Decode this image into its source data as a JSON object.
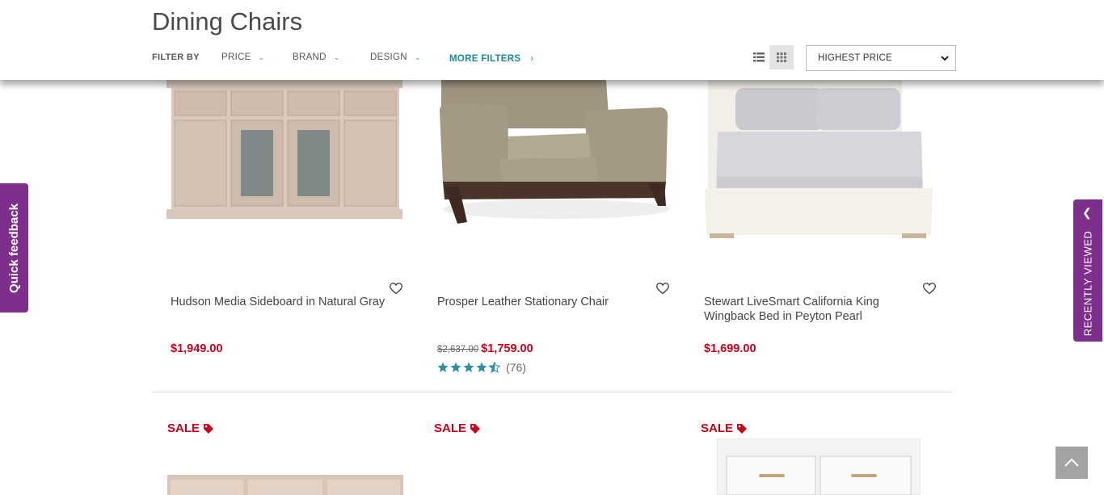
{
  "header": {
    "title": "Dining Chairs",
    "filter_by": "FILTER BY",
    "filters": [
      "PRICE",
      "BRAND",
      "DESIGN"
    ],
    "more_filters": "MORE FILTERS",
    "sort_value": "HIGHEST PRICE"
  },
  "products": [
    {
      "name": "Hudson Media Sideboard in Natural Gray",
      "price": "$1,949.00"
    },
    {
      "name": "Prosper Leather Stationary Chair",
      "old_price": "$2,637.00",
      "price": "$1,759.00",
      "rating": 4.5,
      "review_count": "(76)"
    },
    {
      "name": "Stewart LiveSmart California King Wingback Bed in Peyton Pearl",
      "price": "$1,699.00"
    }
  ],
  "sale_label": "SALE",
  "side_tabs": {
    "quick_feedback": "Quick feedback",
    "recently_viewed": "RECENTLY VIEWED"
  },
  "colors": {
    "accent_purple": "#7d2f8b",
    "price_red": "#c8001a",
    "teal": "#1a8a8f",
    "star": "#2a8fa3"
  }
}
